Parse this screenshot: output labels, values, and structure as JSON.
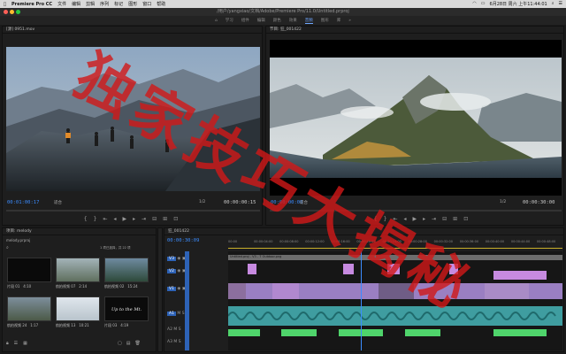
{
  "menubar": {
    "app": "Premiere Pro CC",
    "items": [
      "文件",
      "编辑",
      "剪辑",
      "序列",
      "标记",
      "图形",
      "窗口",
      "帮助"
    ],
    "clock": "6月28日 周六 上午11:44:01"
  },
  "window": {
    "title": "/用户/yangxiao/文档/Adobe/Premiere Pro/11.0/Untitled.prproj"
  },
  "workspaces": [
    "学习",
    "组件",
    "编辑",
    "颜色",
    "效果",
    "音频",
    "图形",
    "库"
  ],
  "workspace_active": "编辑",
  "source": {
    "tab": "源: (无剪辑)",
    "tab2": "[源] 0951.mov",
    "tc_in": "00:01:00:17",
    "fit": "适合",
    "ratio": "1/2",
    "tc_out": "00:00:00:15"
  },
  "program": {
    "tab": "节目: 狂_001422",
    "tc_in": "00:00:00:00",
    "fit": "适合",
    "ratio": "1/2",
    "tc_out": "00:00:30:00"
  },
  "project": {
    "tab": "项目: melody",
    "file": "melody.prproj",
    "count": "1 项已选择，共 22 项",
    "items": [
      {
        "label": "片段 01",
        "dur": "4:10"
      },
      {
        "label": "航拍视频 07",
        "dur": "2:14"
      },
      {
        "label": "航拍视频 02",
        "dur": "15:24"
      },
      {
        "label": "航拍视频 24",
        "dur": "1:17"
      },
      {
        "label": "航拍视频 13",
        "dur": "10:21"
      },
      {
        "label": "片段 03",
        "dur": "4:19"
      }
    ],
    "title_card": "Up to the Mt."
  },
  "timeline": {
    "tab": "狂_001422",
    "tc": "00:00:30:09",
    "ruler": [
      "00:00",
      "00:00:04:00",
      "00:00:08:00",
      "00:00:12:00",
      "00:00:16:00",
      "00:00:20:00",
      "00:00:24:00",
      "00:00:28:00",
      "00:00:32:00",
      "00:00:36:00",
      "00:00:40:00",
      "00:00:44:00",
      "00:00:48:00"
    ],
    "vtracks": [
      "V3",
      "V2",
      "V1"
    ],
    "atracks": [
      "A1",
      "A2",
      "A3"
    ],
    "clip_label": "Untitled.proj - V3 - 7 Outdoor.png"
  },
  "overlay": {
    "text": "独家技巧大揭秘",
    "color": "#d21818"
  },
  "colors": {
    "accent": "#3b8cff",
    "clipPink": "#c78ae0",
    "clipGreen": "#4fd46b",
    "clipTeal": "#3f9da0"
  }
}
